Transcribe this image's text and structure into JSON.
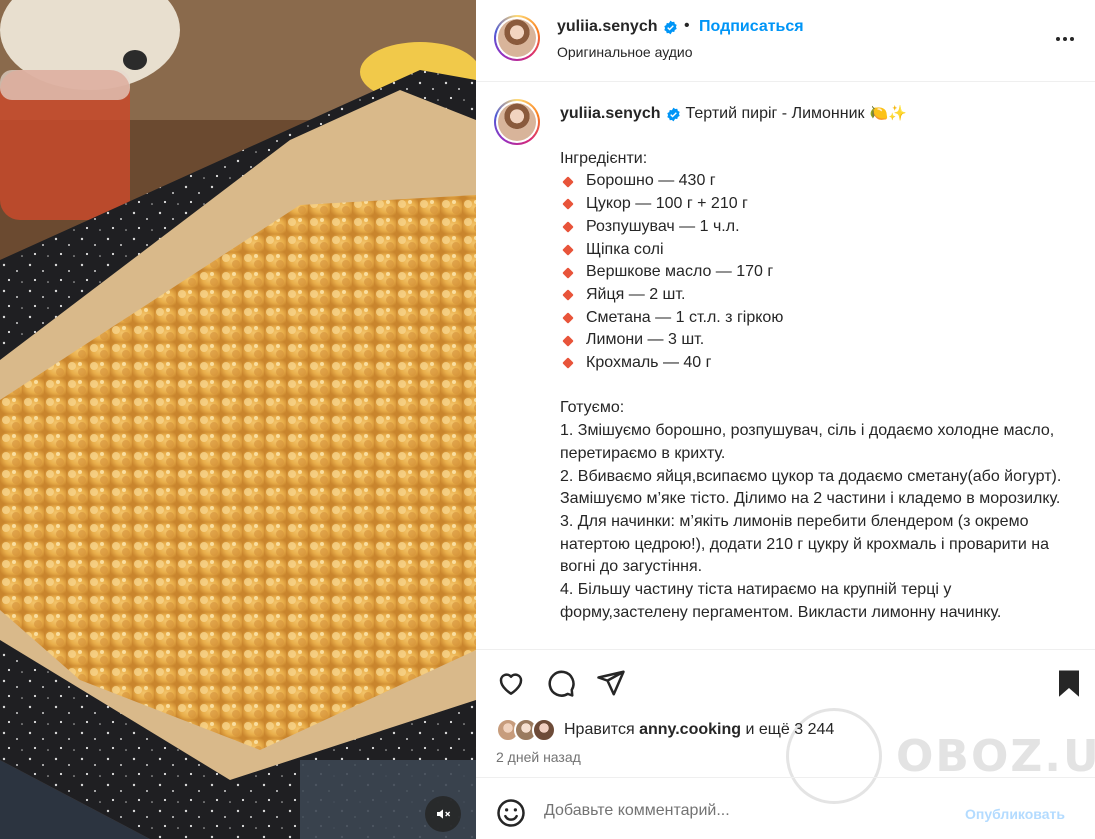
{
  "header": {
    "username": "yuliia.senych",
    "separator": "•",
    "follow_label": "Подписаться",
    "audio_label": "Оригинальное аудио"
  },
  "caption": {
    "username": "yuliia.senych",
    "title": "Тертий пиріг - Лимонник",
    "title_emoji": "🍋✨",
    "ingredients_heading": "Інгредієнти:",
    "ingredients": [
      "Борошно — 430 г",
      "Цукор — 100 г + 210 г",
      "Розпушувач — 1 ч.л.",
      "Щіпка солі",
      "Вершкове масло — 170 г",
      "Яйця — 2 шт.",
      "Сметана — 1 ст.л. з гіркою",
      "Лимони — 3 шт.",
      "Крохмаль — 40 г"
    ],
    "steps_heading": "Готуємо:",
    "steps": [
      "1. Змішуємо борошно, розпушувач, сіль і додаємо холодне масло, перетираємо в крихту.",
      "2. Вбиваємо яйця,всипаємо цукор та додаємо сметану(або йогурт). Замішуємо м’яке тісто. Ділимо на 2 частини і кладемо в морозилку.",
      "3. Для начинки: м’якіть лимонів перебити блендером (з окремо натертою цедрою!), додати 210 г цукру й крохмаль і проварити на вогні до загустіння.",
      "4. Більшу частину тіста натираємо на крупній терці у форму,застелену пергаментом. Викласти лимонну начинку."
    ]
  },
  "likes": {
    "prefix": "Нравится",
    "user": "anny.cooking",
    "suffix": "и ещё 3 244"
  },
  "time_ago": "2 дней назад",
  "comment": {
    "placeholder": "Добавьте комментарий...",
    "publish_label": "Опубликовать"
  },
  "watermark": {
    "text": "OBOZ.UA"
  },
  "colors": {
    "accent": "#0095f6",
    "bullet": "#e8543a",
    "publish_disabled": "#b3dbff"
  },
  "icons": {
    "verified": "verified-badge-icon",
    "more": "more-options-icon",
    "like": "heart-icon",
    "comment": "comment-bubble-icon",
    "share": "paper-plane-icon",
    "save": "bookmark-icon",
    "emoji": "smiley-icon",
    "mute": "speaker-muted-icon"
  }
}
